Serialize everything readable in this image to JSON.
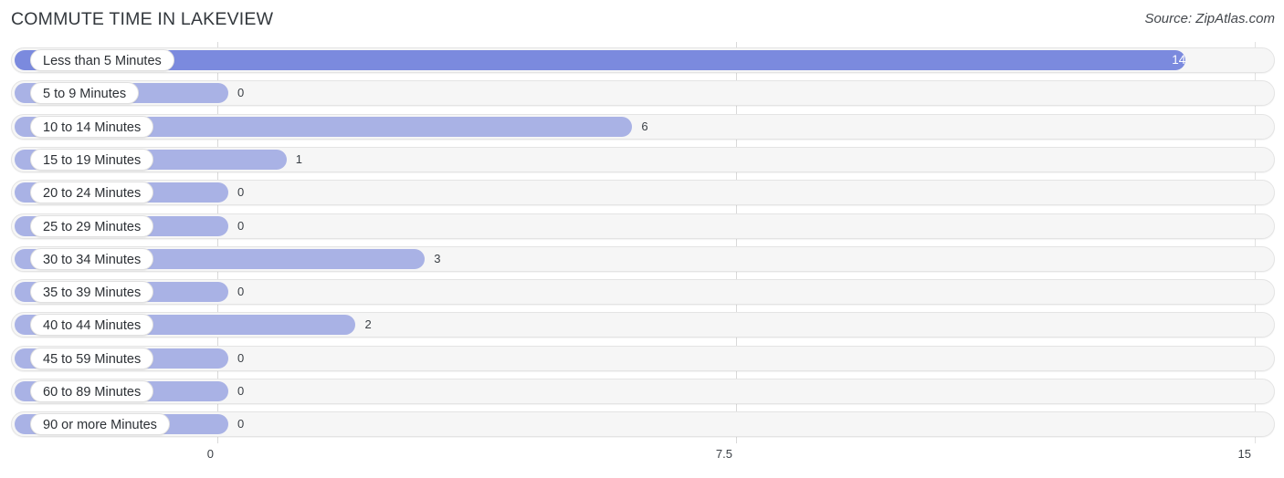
{
  "header": {
    "title": "COMMUTE TIME IN LAKEVIEW",
    "source": "Source: ZipAtlas.com"
  },
  "chart_data": {
    "type": "bar",
    "orientation": "horizontal",
    "title": "COMMUTE TIME IN LAKEVIEW",
    "xlabel": "",
    "ylabel": "",
    "xlim": [
      0,
      15
    ],
    "grid": true,
    "legend": "none",
    "tick_labels": [
      "0",
      "7.5",
      "15"
    ],
    "ticks": [
      0,
      7.5,
      15
    ],
    "categories": [
      "Less than 5 Minutes",
      "5 to 9 Minutes",
      "10 to 14 Minutes",
      "15 to 19 Minutes",
      "20 to 24 Minutes",
      "25 to 29 Minutes",
      "30 to 34 Minutes",
      "35 to 39 Minutes",
      "40 to 44 Minutes",
      "45 to 59 Minutes",
      "60 to 89 Minutes",
      "90 or more Minutes"
    ],
    "values": [
      14,
      0,
      6,
      1,
      0,
      0,
      3,
      0,
      2,
      0,
      0,
      0
    ],
    "value_labels": [
      "14",
      "0",
      "6",
      "1",
      "0",
      "0",
      "3",
      "0",
      "2",
      "0",
      "0",
      "0"
    ],
    "colors": {
      "bar": "#a9b2e5",
      "bar_highlight": "#7b8ade",
      "track": "#f6f6f6",
      "gridline": "#d9d9d9",
      "label_pill": "#ffffff"
    },
    "highlight_index": 0
  }
}
